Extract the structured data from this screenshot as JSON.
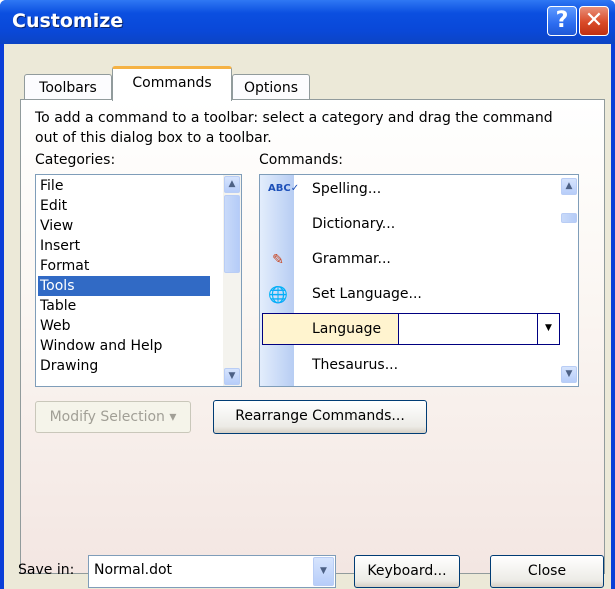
{
  "window": {
    "title": "Customize",
    "help_glyph": "?",
    "close_glyph": "✕"
  },
  "tabs": [
    {
      "label": "Toolbars",
      "active": false
    },
    {
      "label": "Commands",
      "active": true
    },
    {
      "label": "Options",
      "active": false
    }
  ],
  "instructions": "To add a command to a toolbar: select a category and drag the command out of this dialog box to a toolbar.",
  "categories": {
    "label": "Categories:",
    "items": [
      "File",
      "Edit",
      "View",
      "Insert",
      "Format",
      "Tools",
      "Table",
      "Web",
      "Window and Help",
      "Drawing"
    ],
    "selected": "Tools"
  },
  "commands": {
    "label": "Commands:",
    "items": [
      {
        "label": "Spelling...",
        "icon": "spelling-icon"
      },
      {
        "label": "Dictionary...",
        "icon": ""
      },
      {
        "label": "Grammar...",
        "icon": "grammar-icon"
      },
      {
        "label": "Set Language...",
        "icon": "set-language-icon"
      },
      {
        "label": "Language",
        "icon": ""
      },
      {
        "label": "Thesaurus...",
        "icon": ""
      }
    ],
    "selected": "Language"
  },
  "buttons": {
    "modify_selection": "Modify Selection ▾",
    "rearrange_commands": "Rearrange Commands...",
    "keyboard": "Keyboard...",
    "close": "Close"
  },
  "save_in": {
    "label": "Save in:",
    "value": "Normal.dot"
  },
  "colors": {
    "title_bar": "#0a48d8",
    "selection": "#316ac5",
    "tab_highlight": "#f5b244",
    "dialog_bg": "#ece9d8"
  }
}
